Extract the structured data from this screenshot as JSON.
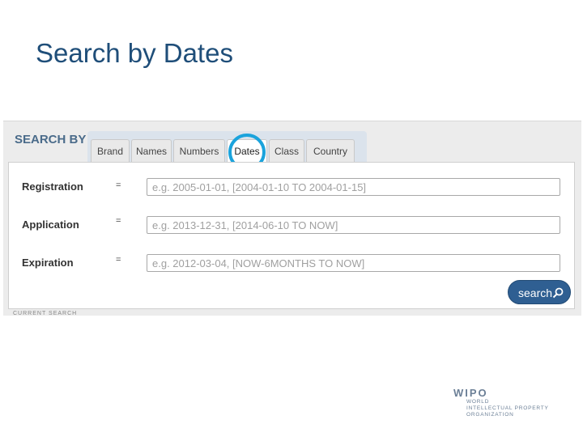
{
  "slide": {
    "title": "Search by Dates"
  },
  "search_panel": {
    "heading": "SEARCH BY",
    "tabs": [
      {
        "label": "Brand"
      },
      {
        "label": "Names"
      },
      {
        "label": "Numbers"
      },
      {
        "label": "Dates",
        "active": true
      },
      {
        "label": "Class"
      },
      {
        "label": "Country"
      }
    ],
    "rows": [
      {
        "label": "Registration",
        "operator": "=",
        "placeholder": "e.g. 2005-01-01, [2004-01-10 TO 2004-01-15]"
      },
      {
        "label": "Application",
        "operator": "=",
        "placeholder": "e.g. 2013-12-31, [2014-06-10 TO NOW]"
      },
      {
        "label": "Expiration",
        "operator": "=",
        "placeholder": "e.g. 2012-03-04, [NOW-6MONTHS TO NOW]"
      }
    ],
    "search_button": {
      "label": "search",
      "icon": "magnifier-icon"
    },
    "footer_label": "CURRENT SEARCH"
  },
  "logo": {
    "name": "WIPO",
    "sub": [
      "WORLD",
      "INTELLECTUAL PROPERTY",
      "ORGANIZATION"
    ]
  },
  "colors": {
    "title": "#1f4e79",
    "highlight_circle": "#1aa3dc",
    "button": "#2f5f92"
  }
}
